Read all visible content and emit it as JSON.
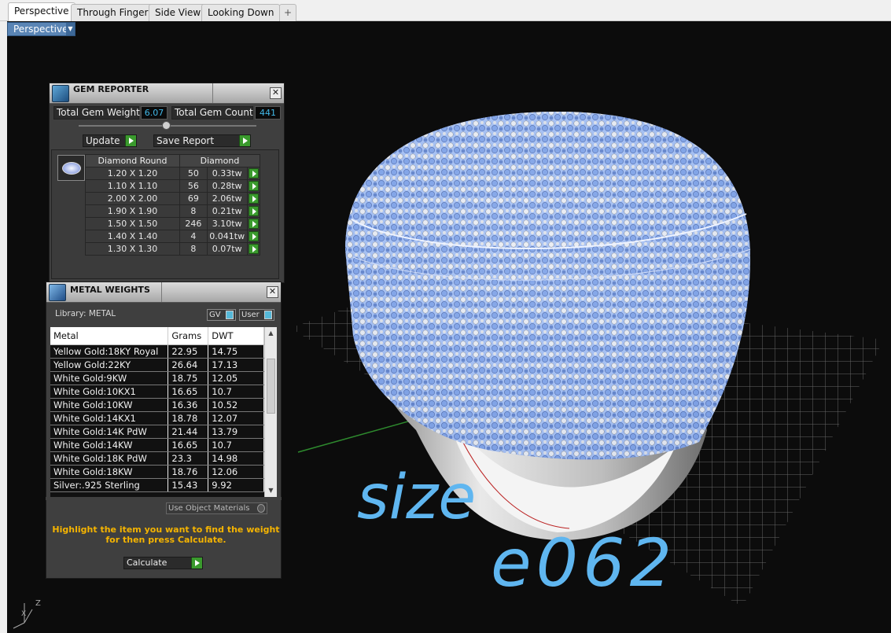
{
  "tabs": [
    {
      "label": "Perspective",
      "active": true
    },
    {
      "label": "Through Finger",
      "active": false
    },
    {
      "label": "Side View",
      "active": false
    },
    {
      "label": "Looking Down",
      "active": false
    }
  ],
  "tab_add_glyph": "+",
  "viewport": {
    "label": "Perspective",
    "dropdown_glyph": "▼"
  },
  "gem_reporter": {
    "title": "GEM REPORTER",
    "close_glyph": "✕",
    "total_weight_label": "Total Gem Weight",
    "total_weight_value": "6.07",
    "total_count_label": "Total Gem Count",
    "total_count_value": "441",
    "update_label": "Update",
    "save_label": "Save Report",
    "table_header_shape": "Diamond Round",
    "table_header_material": "Diamond",
    "rows": [
      {
        "size": "1.20 X 1.20",
        "count": "50",
        "weight": "0.33tw"
      },
      {
        "size": "1.10 X 1.10",
        "count": "56",
        "weight": "0.28tw"
      },
      {
        "size": "2.00 X 2.00",
        "count": "69",
        "weight": "2.06tw"
      },
      {
        "size": "1.90 X 1.90",
        "count": "8",
        "weight": "0.21tw"
      },
      {
        "size": "1.50 X 1.50",
        "count": "246",
        "weight": "3.10tw"
      },
      {
        "size": "1.40 X 1.40",
        "count": "4",
        "weight": "0.041tw"
      },
      {
        "size": "1.30 X 1.30",
        "count": "8",
        "weight": "0.07tw"
      }
    ]
  },
  "metal_weights": {
    "title": "METAL WEIGHTS",
    "close_glyph": "✕",
    "library_label": "Library: METAL",
    "gv_label": "GV",
    "user_label": "User",
    "col_metal": "Metal",
    "col_grams": "Grams",
    "col_dwt": "DWT",
    "rows": [
      {
        "metal": "Yellow Gold:18KY Royal",
        "grams": "22.95",
        "dwt": "14.75"
      },
      {
        "metal": "Yellow Gold:22KY",
        "grams": "26.64",
        "dwt": "17.13"
      },
      {
        "metal": "White Gold:9KW",
        "grams": "18.75",
        "dwt": "12.05"
      },
      {
        "metal": "White Gold:10KX1",
        "grams": "16.65",
        "dwt": "10.7"
      },
      {
        "metal": "White Gold:10KW",
        "grams": "16.36",
        "dwt": "10.52"
      },
      {
        "metal": "White Gold:14KX1",
        "grams": "18.78",
        "dwt": "12.07"
      },
      {
        "metal": "White Gold:14K PdW",
        "grams": "21.44",
        "dwt": "13.79"
      },
      {
        "metal": "White Gold:14KW",
        "grams": "16.65",
        "dwt": "10.7"
      },
      {
        "metal": "White Gold:18K PdW",
        "grams": "23.3",
        "dwt": "14.98"
      },
      {
        "metal": "White Gold:18KW",
        "grams": "18.76",
        "dwt": "12.06"
      },
      {
        "metal": "Silver:.925 Sterling",
        "grams": "15.43",
        "dwt": "9.92"
      }
    ],
    "use_object_materials_label": "Use Object Materials",
    "hint": "Highlight the item you want to find the weight for then press Calculate.",
    "calculate_label": "Calculate"
  },
  "annotation": {
    "line1": "size",
    "line2": "e062"
  },
  "axis": {
    "z": "Z",
    "x": "X"
  },
  "colors": {
    "gem_blue": "#9bbef5",
    "metal_silver": "#d9d9d9",
    "handwriting": "#5fb6f0",
    "hint": "#f5b400",
    "accent_green": "#3a9a2d"
  }
}
